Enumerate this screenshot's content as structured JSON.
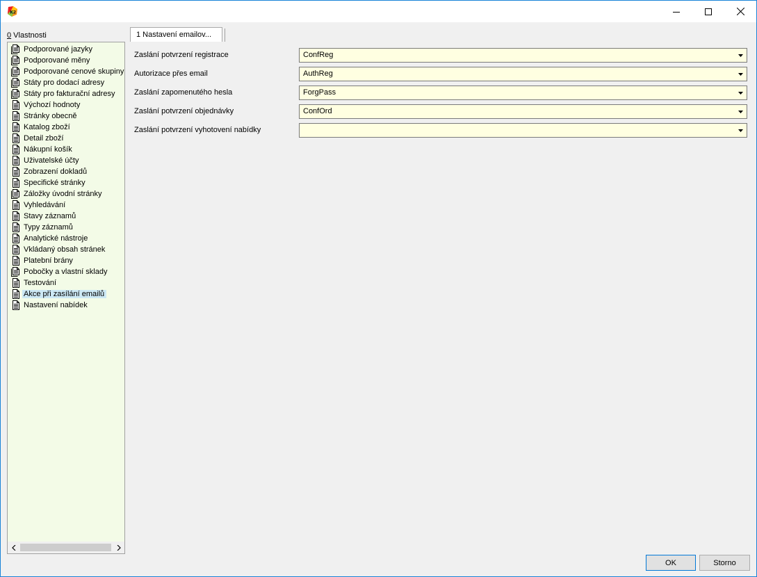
{
  "window": {
    "colors": {
      "accent": "#1883d7",
      "panel_bg": "#f3fbe7",
      "combo_bg": "#ffffe1",
      "selected": "#cce8f4"
    }
  },
  "properties_panel": {
    "label_hotkey": "0",
    "label_text": " Vlastnosti",
    "items": [
      {
        "label": "Podporované jazyky",
        "icon": "multi-doc-icon"
      },
      {
        "label": "Podporované měny",
        "icon": "multi-doc-icon"
      },
      {
        "label": "Podporované cenové skupiny",
        "icon": "multi-doc-icon"
      },
      {
        "label": "Státy pro dodací adresy",
        "icon": "multi-doc-icon"
      },
      {
        "label": "Státy pro fakturační adresy",
        "icon": "multi-doc-icon"
      },
      {
        "label": "Výchozí hodnoty",
        "icon": "doc-icon"
      },
      {
        "label": "Stránky obecně",
        "icon": "doc-icon"
      },
      {
        "label": "Katalog zboží",
        "icon": "doc-icon"
      },
      {
        "label": "Detail zboží",
        "icon": "doc-icon"
      },
      {
        "label": "Nákupní košík",
        "icon": "doc-icon"
      },
      {
        "label": "Uživatelské účty",
        "icon": "doc-icon"
      },
      {
        "label": "Zobrazení dokladů",
        "icon": "doc-icon"
      },
      {
        "label": "Specifické stránky",
        "icon": "doc-icon"
      },
      {
        "label": "Záložky úvodní stránky",
        "icon": "multi-doc-icon"
      },
      {
        "label": "Vyhledávání",
        "icon": "doc-icon"
      },
      {
        "label": "Stavy záznamů",
        "icon": "doc-icon"
      },
      {
        "label": "Typy záznamů",
        "icon": "doc-icon"
      },
      {
        "label": "Analytické nástroje",
        "icon": "doc-icon"
      },
      {
        "label": "Vkládaný obsah stránek",
        "icon": "doc-icon"
      },
      {
        "label": "Platební brány",
        "icon": "doc-icon"
      },
      {
        "label": "Pobočky a vlastní sklady",
        "icon": "multi-doc-icon"
      },
      {
        "label": "Testování",
        "icon": "doc-icon"
      },
      {
        "label": "Akce při zasílání emailů",
        "icon": "doc-icon",
        "selected": true
      },
      {
        "label": "Nastavení nabídek",
        "icon": "doc-icon"
      }
    ]
  },
  "tabs": [
    {
      "label": "1 Nastavení emailov..."
    }
  ],
  "form": {
    "rows": [
      {
        "label": "Zaslání potvrzení registrace",
        "value": "ConfReg"
      },
      {
        "label": "Autorizace přes email",
        "value": "AuthReg"
      },
      {
        "label": "Zaslání zapomenutého hesla",
        "value": "ForgPass"
      },
      {
        "label": "Zaslání potvrzení objednávky",
        "value": "ConfOrd"
      },
      {
        "label": "Zaslání potvrzení vyhotovení nabídky",
        "value": ""
      }
    ]
  },
  "footer": {
    "ok_label": "OK",
    "storno_label": "Storno"
  }
}
